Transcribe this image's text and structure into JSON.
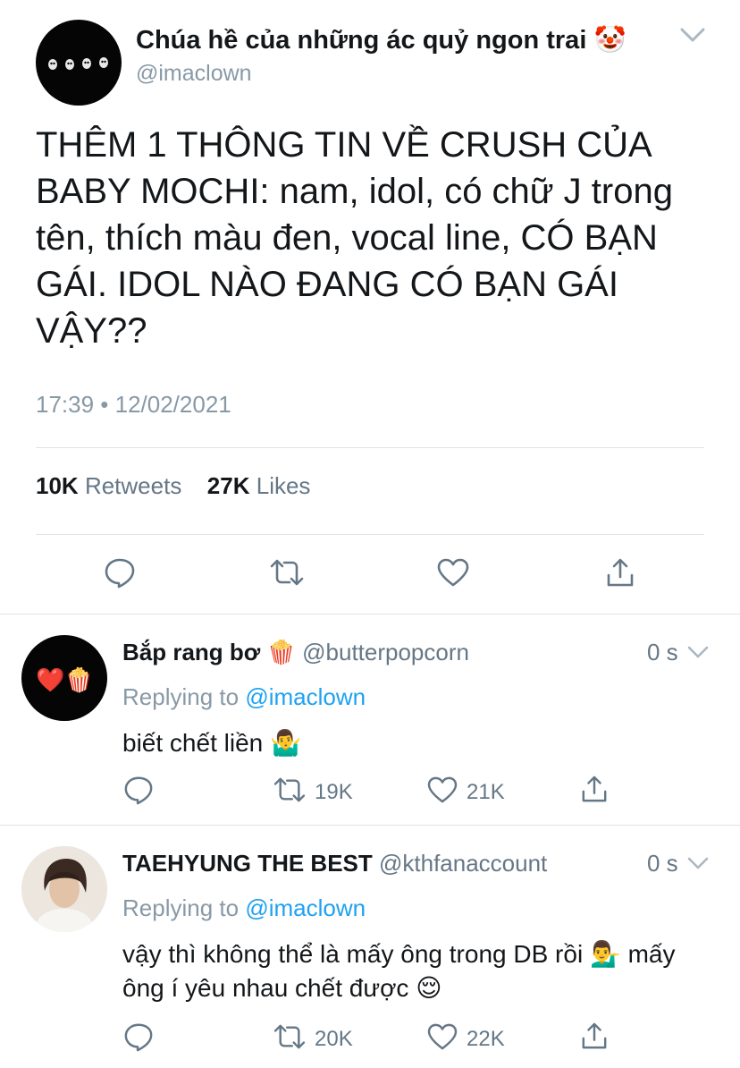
{
  "main_tweet": {
    "display_name": "Chúa hề của những ác quỷ ngon trai",
    "name_emoji": "🤡",
    "handle": "@imaclown",
    "text": "THÊM 1 THÔNG TIN VỀ CRUSH CỦA BABY MOCHI: nam, idol, có chữ J trong tên, thích màu đen, vocal line, CÓ BẠN GÁI. IDOL NÀO ĐANG CÓ BẠN GÁI VẬY??",
    "timestamp": "17:39 • 12/02/2021",
    "retweets_count": "10K",
    "retweets_label": "Retweets",
    "likes_count": "27K",
    "likes_label": "Likes"
  },
  "replies": [
    {
      "display_name": "Bắp rang bơ",
      "name_emoji": "🍿",
      "handle": "@butterpopcorn",
      "time": "0 s",
      "replying_prefix": "Replying to",
      "replying_to": "@imaclown",
      "text": "biết chết liền 🤷‍♂️",
      "retweets": "19K",
      "likes": "21K",
      "avatar_emojis": "❤️🍿"
    },
    {
      "display_name": "TAEHYUNG THE BEST",
      "handle": "@kthfanaccount",
      "time": "0 s",
      "replying_prefix": "Replying to",
      "replying_to": "@imaclown",
      "text": "vậy thì không thể là mấy ông trong DB rồi 💁‍♂️ mấy ông í yêu nhau chết được 😌",
      "retweets": "20K",
      "likes": "22K"
    }
  ],
  "colors": {
    "text": "#14171a",
    "muted": "#657786",
    "light_muted": "#8899a6",
    "link": "#1da1f2",
    "divider": "#dfe3e6"
  },
  "icons": [
    "reply-icon",
    "retweet-icon",
    "like-icon",
    "share-icon",
    "chevron-down-icon"
  ]
}
